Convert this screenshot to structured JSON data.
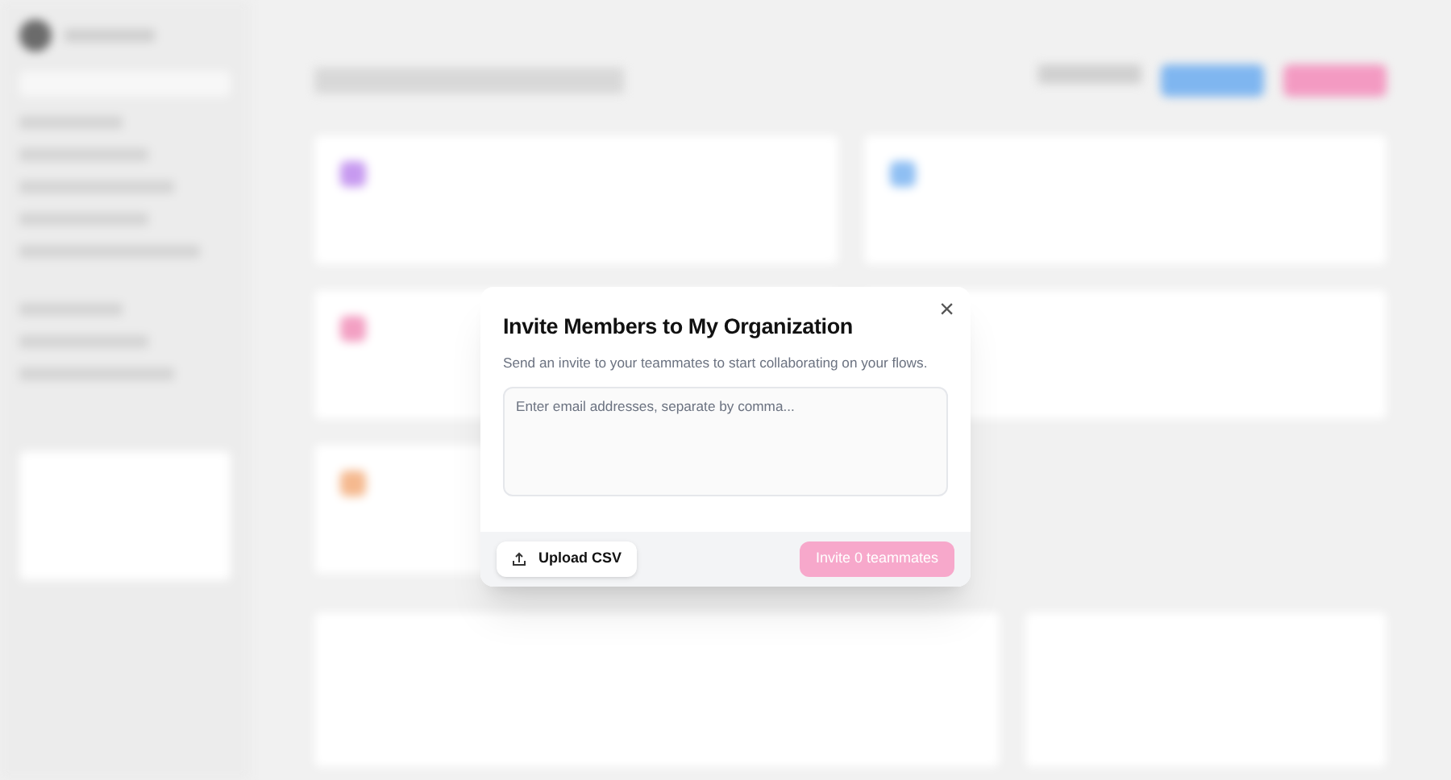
{
  "dialog": {
    "title": "Invite Members to My Organization",
    "description": "Send an invite to your teammates to start collaborating on your flows.",
    "close": "×",
    "email_field": {
      "placeholder": "Enter email addresses, separate by comma..."
    },
    "upload_button": {
      "label": "Upload CSV"
    },
    "invite_button": {
      "label": "Invite 0 teammates",
      "disabled": true
    }
  }
}
